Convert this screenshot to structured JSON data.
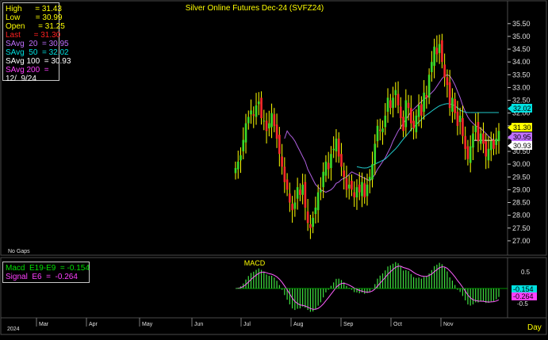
{
  "chart": {
    "title": "Silver Online Futures Dec-24 (SVFZ24)",
    "no_gaps_label": "No Gaps",
    "macd_title": "MACD",
    "day_label": "Day",
    "year_label": "2024",
    "months": [
      "Mar",
      "Apr",
      "May",
      "Jun",
      "Jul",
      "Aug",
      "Sep",
      "Oct",
      "Nov"
    ]
  },
  "info_box": {
    "lines": [
      {
        "label": "High",
        "value": "31.43",
        "color": "#ffff00"
      },
      {
        "label": "Low",
        "value": "30.99",
        "color": "#ffff00"
      },
      {
        "label": "Open",
        "value": "31.25",
        "color": "#ffff00"
      },
      {
        "label": "Last",
        "value": "31.30",
        "color": "#ff2020"
      },
      {
        "label": "SAvg  20",
        "value": "30.95",
        "color": "#c070ff"
      },
      {
        "label": "SAvg  50",
        "value": "32.02",
        "color": "#00e0e0"
      },
      {
        "label": "SAvg 100",
        "value": "30.93",
        "color": "#ffffff"
      },
      {
        "label": "SAvg 200",
        "value": "",
        "color": "#ff40ff"
      }
    ],
    "date": "12/  9/24"
  },
  "macd_box": {
    "macd_label": "Macd  E19-E9  = -0.154",
    "signal_label": "Signal  E6  =  -0.264"
  },
  "price_badges": [
    {
      "value": "32.02",
      "color": "#00e0e0"
    },
    {
      "value": "31.30",
      "color": "#ffff00"
    },
    {
      "value": "30.95",
      "color": "#c070ff"
    },
    {
      "value": "30.93",
      "color": "#ffffff"
    }
  ],
  "macd_badges": [
    {
      "value": "-0.154",
      "color": "#00e0e0"
    },
    {
      "value": "-0.264",
      "color": "#ff40ff"
    }
  ],
  "chart_data": {
    "type": "candlestick",
    "title": "Silver Online Futures Dec-24 (SVFZ24)",
    "y_ticks": [
      "27.00",
      "27.50",
      "28.00",
      "28.50",
      "29.00",
      "29.50",
      "30.00",
      "30.50",
      "31.00",
      "31.50",
      "32.00",
      "32.50",
      "33.00",
      "33.50",
      "34.00",
      "34.50",
      "35.00",
      "35.50"
    ],
    "ylim": [
      26.5,
      36.3
    ],
    "closes": [
      29.85,
      30.1,
      30.35,
      30.95,
      31.6,
      31.85,
      32.1,
      31.9,
      32.3,
      32.45,
      31.8,
      31.7,
      31.3,
      31.6,
      32.0,
      31.5,
      31.0,
      30.4,
      29.9,
      29.3,
      29.0,
      28.5,
      28.2,
      28.5,
      29.1,
      28.8,
      29.2,
      28.3,
      27.7,
      27.5,
      27.9,
      28.3,
      28.9,
      29.0,
      29.7,
      30.1,
      29.8,
      30.4,
      30.6,
      31.0,
      30.3,
      29.9,
      29.5,
      29.0,
      29.2,
      29.0,
      28.7,
      29.1,
      28.9,
      29.3,
      28.7,
      29.2,
      29.5,
      30.0,
      30.8,
      31.5,
      31.3,
      31.4,
      31.9,
      32.6,
      32.2,
      32.6,
      32.9,
      32.3,
      31.8,
      31.3,
      32.5,
      32.2,
      31.6,
      31.4,
      31.9,
      32.3,
      31.9,
      32.8,
      32.6,
      33.5,
      34.0,
      34.6,
      34.3,
      34.7,
      34.0,
      33.4,
      33.1,
      32.2,
      32.6,
      32.0,
      31.5,
      31.9,
      31.1,
      30.6,
      30.2,
      30.7,
      31.2,
      31.5,
      30.9,
      31.2,
      30.8,
      30.3,
      30.6,
      30.9,
      30.6,
      31.0,
      31.3
    ],
    "sma20": [
      null,
      null,
      null,
      null,
      null,
      null,
      null,
      null,
      null,
      null,
      null,
      null,
      null,
      null,
      null,
      null,
      null,
      null,
      null,
      31.0,
      31.3,
      31.15,
      31.05,
      30.9,
      30.7,
      30.5,
      30.3,
      30.1,
      29.8,
      29.6,
      29.4,
      29.2,
      29.1,
      29.0,
      28.95,
      28.9,
      28.95,
      29.0,
      29.1,
      29.25,
      29.3,
      29.4,
      29.45,
      29.5,
      29.6,
      29.7,
      29.65,
      29.6,
      29.55,
      29.5,
      29.45,
      29.4,
      29.35,
      29.45,
      29.6,
      29.8,
      29.95,
      30.1,
      30.25,
      30.45,
      30.65,
      30.9,
      31.1,
      31.3,
      31.45,
      31.6,
      31.75,
      31.9,
      32.05,
      32.15,
      32.25,
      32.35,
      32.45,
      32.55,
      32.6,
      32.7,
      32.8,
      32.9,
      33.05,
      33.2,
      33.35,
      33.45,
      33.5,
      33.45,
      33.3,
      33.1,
      32.85,
      32.6,
      32.3,
      32.05,
      31.85,
      31.7,
      31.6,
      31.5,
      31.45,
      31.4,
      31.3,
      31.2,
      31.1,
      31.0,
      30.95
    ],
    "sma50": [
      null,
      null,
      null,
      null,
      null,
      null,
      null,
      null,
      null,
      null,
      null,
      null,
      null,
      null,
      null,
      null,
      null,
      null,
      null,
      null,
      null,
      null,
      null,
      null,
      null,
      null,
      null,
      null,
      null,
      null,
      null,
      null,
      null,
      null,
      null,
      null,
      null,
      null,
      null,
      null,
      null,
      null,
      null,
      null,
      null,
      null,
      null,
      29.9,
      29.88,
      29.86,
      29.85,
      29.86,
      29.9,
      29.95,
      30.0,
      30.05,
      30.1,
      30.15,
      30.2,
      30.3,
      30.4,
      30.5,
      30.6,
      30.72,
      30.85,
      30.98,
      31.1,
      31.22,
      31.35,
      31.45,
      31.55,
      31.65,
      31.75,
      31.85,
      31.93,
      32.0,
      32.08,
      32.15,
      32.22,
      32.28,
      32.32,
      32.35,
      32.37,
      32.36,
      32.33,
      32.28,
      32.2,
      32.12,
      32.06,
      32.04,
      32.02,
      32.02
    ]
  }
}
